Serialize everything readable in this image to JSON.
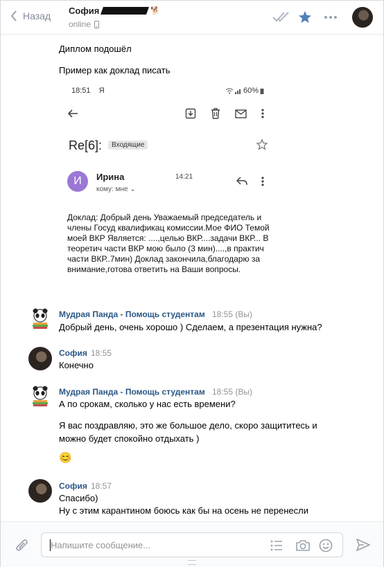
{
  "header": {
    "back_label": "Назад",
    "user_name": "София",
    "status": "online"
  },
  "chat": {
    "first_lines": [
      "Диплом подошёл",
      "Пример как доклад писать"
    ],
    "embedded_mail": {
      "status_time": "18:51",
      "status_app": "Я",
      "battery": "60%",
      "subject": "Re[6]:",
      "folder": "Входящие",
      "sender_initial": "И",
      "sender_name": "Ирина",
      "sender_time": "14:21",
      "to_label": "кому: мне",
      "body": "Доклад: Добрый день Уважаемый председатель и члены  Госуд квалификац комиссии.Мое ФИО Темой моей ВКР Является: ....,целью ВКР....задачи ВКР... В теоретич части ВКР мою было (3 мин)....,в практич части ВКР..7мин) Доклад закончила,благодарю за внимание,готова ответить на Ваши вопросы."
    },
    "messages": [
      {
        "author": "Мудрая Панда - Помощь студентам",
        "time": "18:55 (Вы)",
        "lines": [
          "Добрый день, очень хорошо ) Сделаем, а презентация нужна?"
        ]
      },
      {
        "author": "София",
        "time": "18:55",
        "lines": [
          "Конечно"
        ]
      },
      {
        "author": "Мудрая Панда - Помощь студентам",
        "time": "18:55 (Вы)",
        "lines": [
          "А по срокам, сколько у нас есть времени?",
          "Я вас поздравляю, это же большое дело, скоро защититесь и",
          "можно будет спокойно отдыхать )",
          "😊"
        ]
      },
      {
        "author": "София",
        "time": "18:57",
        "lines": [
          "Спасибо)",
          "Ну с этим карантином боюсь как бы на осень не перенесли"
        ]
      }
    ]
  },
  "composer": {
    "placeholder": "Напишите сообщение..."
  },
  "colors": {
    "accent": "#5181b8",
    "author": "#2a5885",
    "muted": "#939393"
  },
  "icons": [
    "chevron-left-icon",
    "phone-icon",
    "double-check-icon",
    "star-icon",
    "more-icon",
    "paperclip-icon",
    "template-list-icon",
    "camera-icon",
    "smile-icon",
    "send-icon"
  ]
}
